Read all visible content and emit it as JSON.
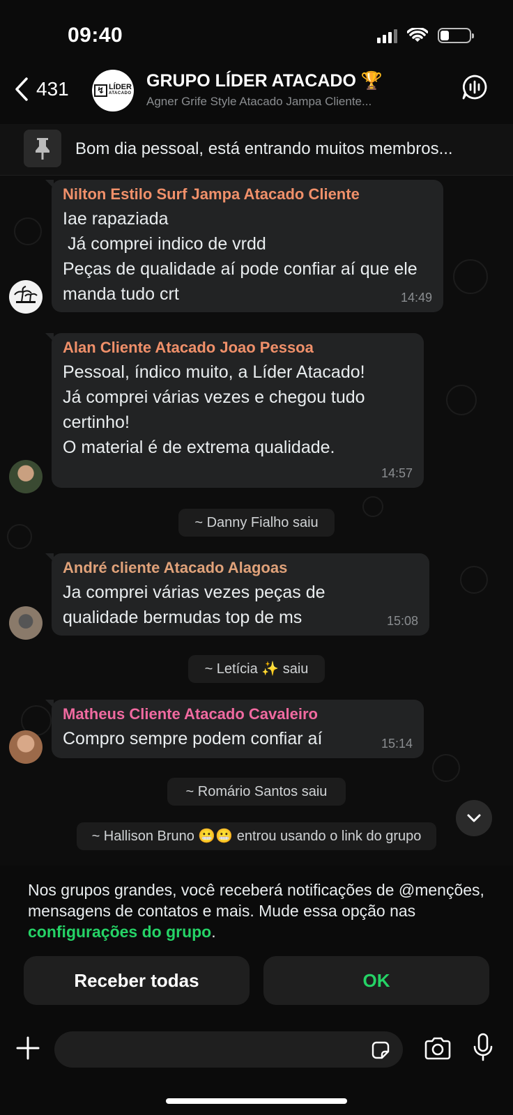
{
  "status": {
    "time": "09:40"
  },
  "header": {
    "back_count": "431",
    "title": "GRUPO LÍDER ATACADO 🏆",
    "subtitle": "Agner Grife Style Atacado Jampa Cliente...",
    "logo": {
      "brand": "LÍDER",
      "tag": "ATACADO"
    }
  },
  "pinned": {
    "text": "Bom dia pessoal, está entrando muitos membros..."
  },
  "messages": [
    {
      "sender": "Nilton Estilo Surf Jampa Atacado Cliente",
      "sender_color": "#f0906a",
      "text": "Iae rapaziada\n Já comprei indico de vrdd\nPeças de qualidade aí pode confiar aí que ele manda tudo crt",
      "time": "14:49"
    },
    {
      "sender": "Alan Cliente Atacado Joao Pessoa",
      "sender_color": "#f0906a",
      "text": "Pessoal, índico muito, a Líder Atacado!\nJá comprei várias vezes e chegou tudo certinho!\nO material é de extrema qualidade.",
      "time": "14:57"
    },
    {
      "sender": "André cliente Atacado Alagoas",
      "sender_color": "#e0a27a",
      "text": "Ja comprei várias vezes peças de qualidade bermudas top de ms",
      "time": "15:08"
    },
    {
      "sender": "Matheus Cliente Atacado Cavaleiro",
      "sender_color": "#f06aa0",
      "text": "Compro sempre podem confiar aí",
      "time": "15:14"
    }
  ],
  "system_messages": [
    "~ Danny Fialho saiu",
    "~ Letícia ✨ saiu",
    "~ Romário Santos saiu",
    "~ Hallison Bruno 😬😬 entrou usando o link do grupo"
  ],
  "notice": {
    "text": "Nos grupos grandes, você receberá notificações de @menções, mensagens de contatos e mais. Mude essa opção nas ",
    "link": "configurações do grupo",
    "end": ".",
    "btn_all": "Receber todas",
    "btn_ok": "OK"
  },
  "colors": {
    "accent": "#25d366",
    "bubble": "#222324"
  }
}
